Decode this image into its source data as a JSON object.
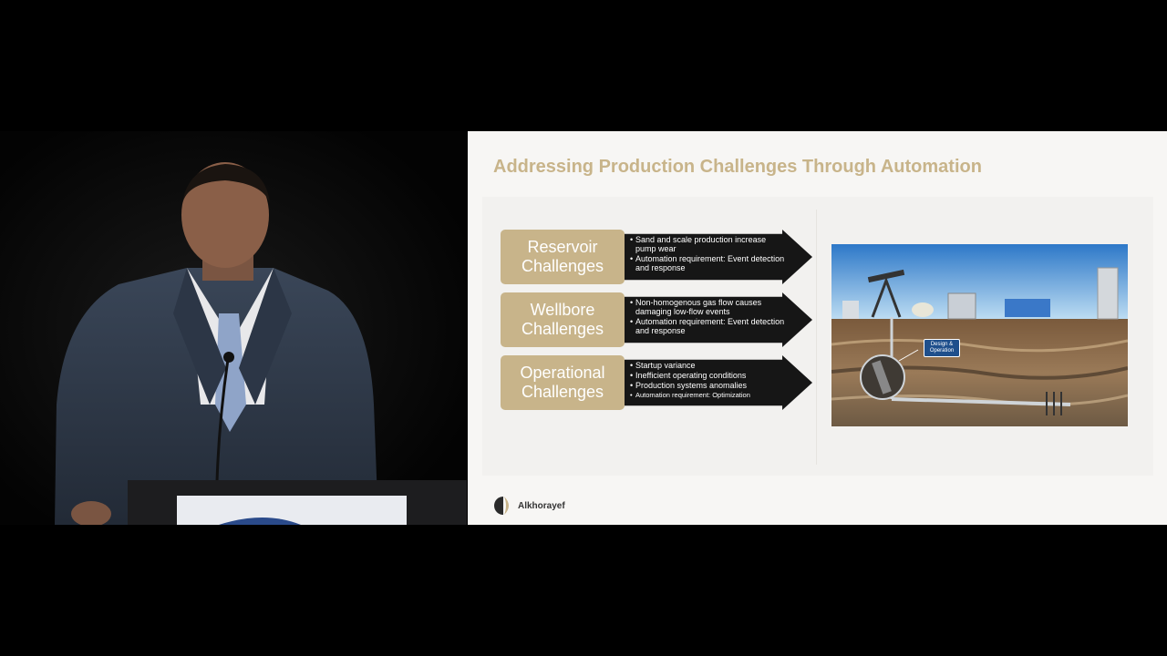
{
  "slide": {
    "title": "Addressing Production Challenges Through Automation",
    "rows": [
      {
        "label": [
          "Reservoir",
          "Challenges"
        ],
        "bullets": [
          "Sand and scale production increase pump wear",
          "Automation requirement: Event detection and response"
        ]
      },
      {
        "label": [
          "Wellbore",
          "Challenges"
        ],
        "bullets": [
          "Non-homogenous gas flow causes damaging low-flow events",
          "Automation requirement: Event detection and response"
        ]
      },
      {
        "label": [
          "Operational",
          "Challenges"
        ],
        "bullets": [
          "Startup variance",
          "Inefficient operating conditions",
          "Production systems anomalies",
          "Automation requirement: Optimization"
        ]
      }
    ],
    "badge": [
      "Design &",
      "Operation"
    ],
    "logo_text": "Alkhorayef"
  },
  "colors": {
    "accent_gold": "#c8b48a",
    "arrow_dark": "#161616",
    "badge_blue": "#1e4f8c"
  }
}
